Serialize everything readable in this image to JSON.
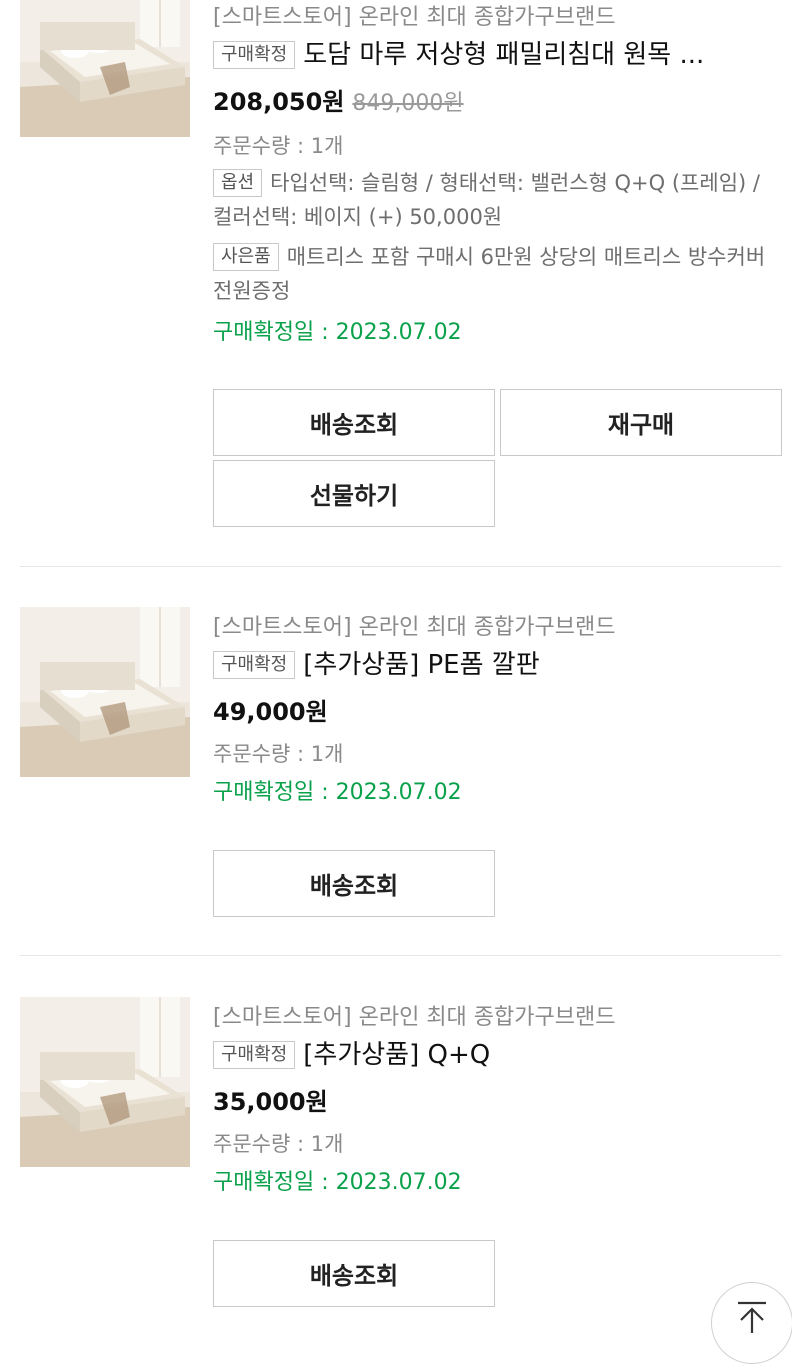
{
  "products": [
    {
      "store": "[스마트스토어] 온라인 최대 종합가구브랜드",
      "status_tag": "구매확정",
      "title": "도담 마루 저상형 패밀리침대 원목 ...",
      "price": "208,050원",
      "original_price": "849,000원",
      "quantity": "주문수량 : 1개",
      "option_tag": "옵션",
      "option_text": "타입선택: 슬림형 / 형태선택: 밸런스형 Q+Q (프레임) / 컬러선택: 베이지 (+) 50,000원",
      "gift_tag": "사은품",
      "gift_text": "매트리스 포함 구매시 6만원 상당의 매트리스 방수커버 전원증정",
      "confirm_date": "구매확정일 : 2023.07.02",
      "buttons": {
        "track": "배송조회",
        "rebuy": "재구매",
        "gift": "선물하기"
      }
    },
    {
      "store": "[스마트스토어] 온라인 최대 종합가구브랜드",
      "status_tag": "구매확정",
      "title": "[추가상품] PE폼 깔판",
      "price": "49,000원",
      "quantity": "주문수량 : 1개",
      "confirm_date": "구매확정일 : 2023.07.02",
      "buttons": {
        "track": "배송조회"
      }
    },
    {
      "store": "[스마트스토어] 온라인 최대 종합가구브랜드",
      "status_tag": "구매확정",
      "title": "[추가상품] Q+Q",
      "price": "35,000원",
      "quantity": "주문수량 : 1개",
      "confirm_date": "구매확정일 : 2023.07.02",
      "buttons": {
        "track": "배송조회"
      }
    }
  ],
  "scroll_top_icon": "arrow-up-to-top-icon",
  "colors": {
    "confirm_green": "#0aa14b",
    "muted_gray": "#8a8a8a",
    "border": "#c9c9c9"
  }
}
